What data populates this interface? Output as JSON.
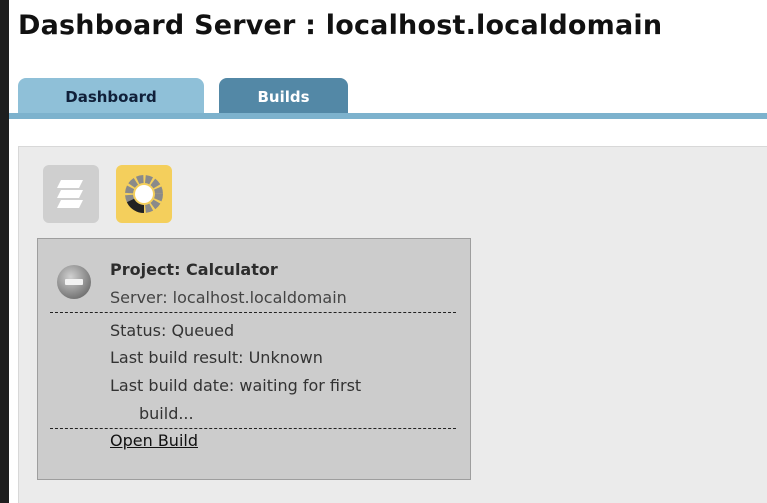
{
  "header": {
    "title": "Dashboard Server : localhost.localdomain"
  },
  "tabs": [
    {
      "label": "Dashboard",
      "active": true
    },
    {
      "label": "Builds",
      "active": false
    }
  ],
  "toolbar": {
    "list_view_icon": "layers-icon",
    "status_view_icon": "status-ring-icon"
  },
  "project_card": {
    "project": "Project: Calculator",
    "server": "Server: localhost.localdomain",
    "status": "Status: Queued",
    "last_result": "Last build result: Unknown",
    "last_date_line1": "Last build date: waiting for first",
    "last_date_line2": "build...",
    "open_link": "Open Build",
    "state_icon": "stop-icon"
  },
  "colors": {
    "tab_active": "#8fc0d8",
    "tab_inactive": "#5388a6",
    "card_bg": "#cccccc",
    "status_icon_bg": "#f4cf5c"
  }
}
